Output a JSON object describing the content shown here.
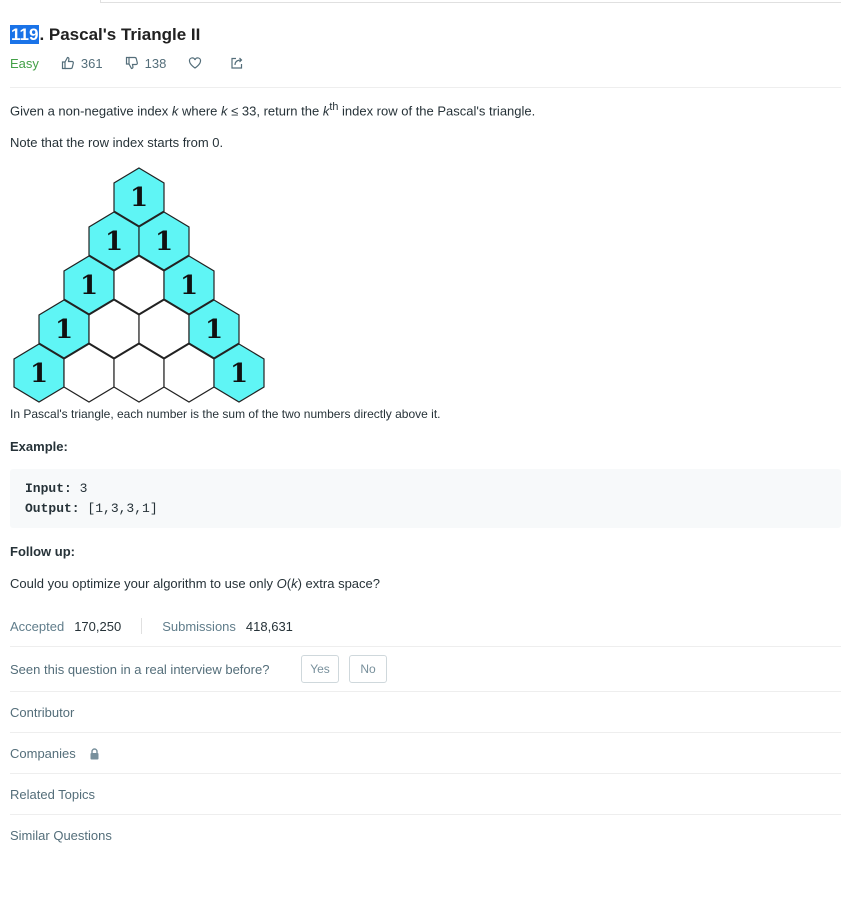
{
  "problem": {
    "number": "119",
    "title_rest": ". Pascal's Triangle II",
    "difficulty": "Easy",
    "likes": "361",
    "dislikes": "138"
  },
  "description": {
    "p1_a": "Given a non-negative index ",
    "p1_k1": "k",
    "p1_b": " where ",
    "p1_k2": "k",
    "p1_c": " ≤ 33, return the ",
    "p1_k3": "k",
    "p1_th": "th",
    "p1_d": " index row of the Pascal's triangle.",
    "p2": "Note that the row index starts from 0.",
    "caption": "In Pascal's triangle, each number is the sum of the two numbers directly above it."
  },
  "triangle": {
    "cell_value": "1",
    "fill_color": "#5ff5f5",
    "empty_color": "#ffffff",
    "stroke_color": "#222222"
  },
  "example": {
    "heading": "Example:",
    "input_label": "Input:",
    "input_value": " 3",
    "output_label": "Output:",
    "output_value": " [1,3,3,1]"
  },
  "followup": {
    "heading": "Follow up:",
    "text_a": "Could you optimize your algorithm to use only ",
    "text_o": "O",
    "text_paren_open": "(",
    "text_k": "k",
    "text_b": ") extra space?"
  },
  "stats": {
    "accepted_label": "Accepted",
    "accepted_value": "170,250",
    "submissions_label": "Submissions",
    "submissions_value": "418,631"
  },
  "interview": {
    "question": "Seen this question in a real interview before?",
    "yes": "Yes",
    "no": "No"
  },
  "sections": {
    "contributor": "Contributor",
    "companies": "Companies",
    "related_topics": "Related Topics",
    "similar_questions": "Similar Questions"
  },
  "colors": {
    "easy": "#43a047",
    "highlight": "#1a73e8"
  },
  "icons": [
    "thumbs-up-icon",
    "thumbs-down-icon",
    "heart-icon",
    "share-icon",
    "lock-icon"
  ]
}
